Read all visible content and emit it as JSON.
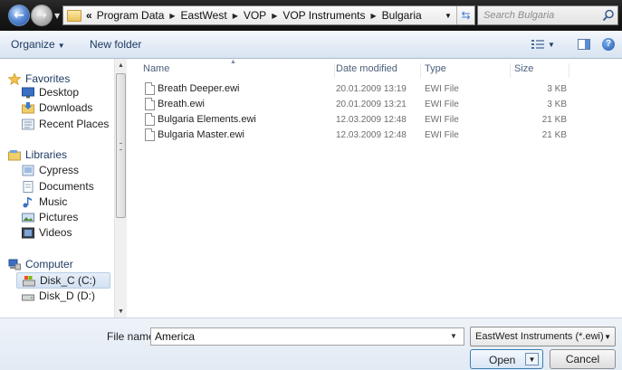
{
  "address": {
    "overflow": "«",
    "breadcrumbs": [
      "Program Data",
      "EastWest",
      "VOP",
      "VOP Instruments",
      "Bulgaria"
    ]
  },
  "search": {
    "placeholder": "Search Bulgaria"
  },
  "toolbar": {
    "organize_label": "Organize",
    "new_folder_label": "New folder"
  },
  "nav": {
    "favorites": {
      "label": "Favorites",
      "items": [
        "Desktop",
        "Downloads",
        "Recent Places"
      ]
    },
    "libraries": {
      "label": "Libraries",
      "items": [
        "Cypress",
        "Documents",
        "Music",
        "Pictures",
        "Videos"
      ]
    },
    "computer": {
      "label": "Computer",
      "items": [
        "Disk_C (C:)",
        "Disk_D (D:)"
      ],
      "selected": "Disk_C (C:)"
    }
  },
  "columns": {
    "name": "Name",
    "date": "Date modified",
    "type": "Type",
    "size": "Size"
  },
  "files": [
    {
      "name": "Breath Deeper.ewi",
      "date": "20.01.2009 13:19",
      "type": "EWI File",
      "size": "3 KB"
    },
    {
      "name": "Breath.ewi",
      "date": "20.01.2009 13:21",
      "type": "EWI File",
      "size": "3 KB"
    },
    {
      "name": "Bulgaria Elements.ewi",
      "date": "12.03.2009 12:48",
      "type": "EWI File",
      "size": "21 KB"
    },
    {
      "name": "Bulgaria Master.ewi",
      "date": "12.03.2009 12:48",
      "type": "EWI File",
      "size": "21 KB"
    }
  ],
  "bottom": {
    "file_name_label": "File name:",
    "file_name_value": "America",
    "file_type": "EastWest Instruments (*.ewi)",
    "open_label": "Open",
    "cancel_label": "Cancel"
  }
}
